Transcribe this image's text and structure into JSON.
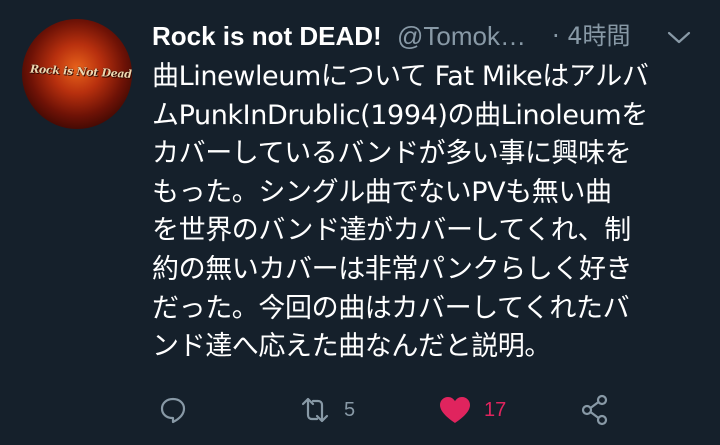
{
  "author": {
    "display_name": "Rock is not DEAD!",
    "handle": "@Tomok…",
    "avatar_text": "Rock is Not Dead"
  },
  "timestamp": "· 4時間",
  "tweet": {
    "lines": [
      "曲Linewleumについて Fat Mikeはアルバ",
      "ムPunkInDrublic(1994)の曲Linoleumを",
      "カバーしているバンドが多い事に興味を",
      "もった。シングル曲でないPVも無い曲",
      "を世界のバンド達がカバーしてくれ、制",
      "約の無いカバーは非常パンクらしく好き",
      "だった。今回の曲はカバーしてくれたバ",
      "ンド達へ応えた曲なんだと説明。"
    ]
  },
  "actions": {
    "reply_icon": "reply-icon",
    "retweet_icon": "retweet-icon",
    "retweet_count": "5",
    "like_icon": "heart-icon",
    "like_count": "17",
    "share_icon": "share-icon"
  },
  "colors": {
    "background": "#15202b",
    "text": "#ffffff",
    "muted": "#8899a6",
    "like": "#e0245e"
  }
}
